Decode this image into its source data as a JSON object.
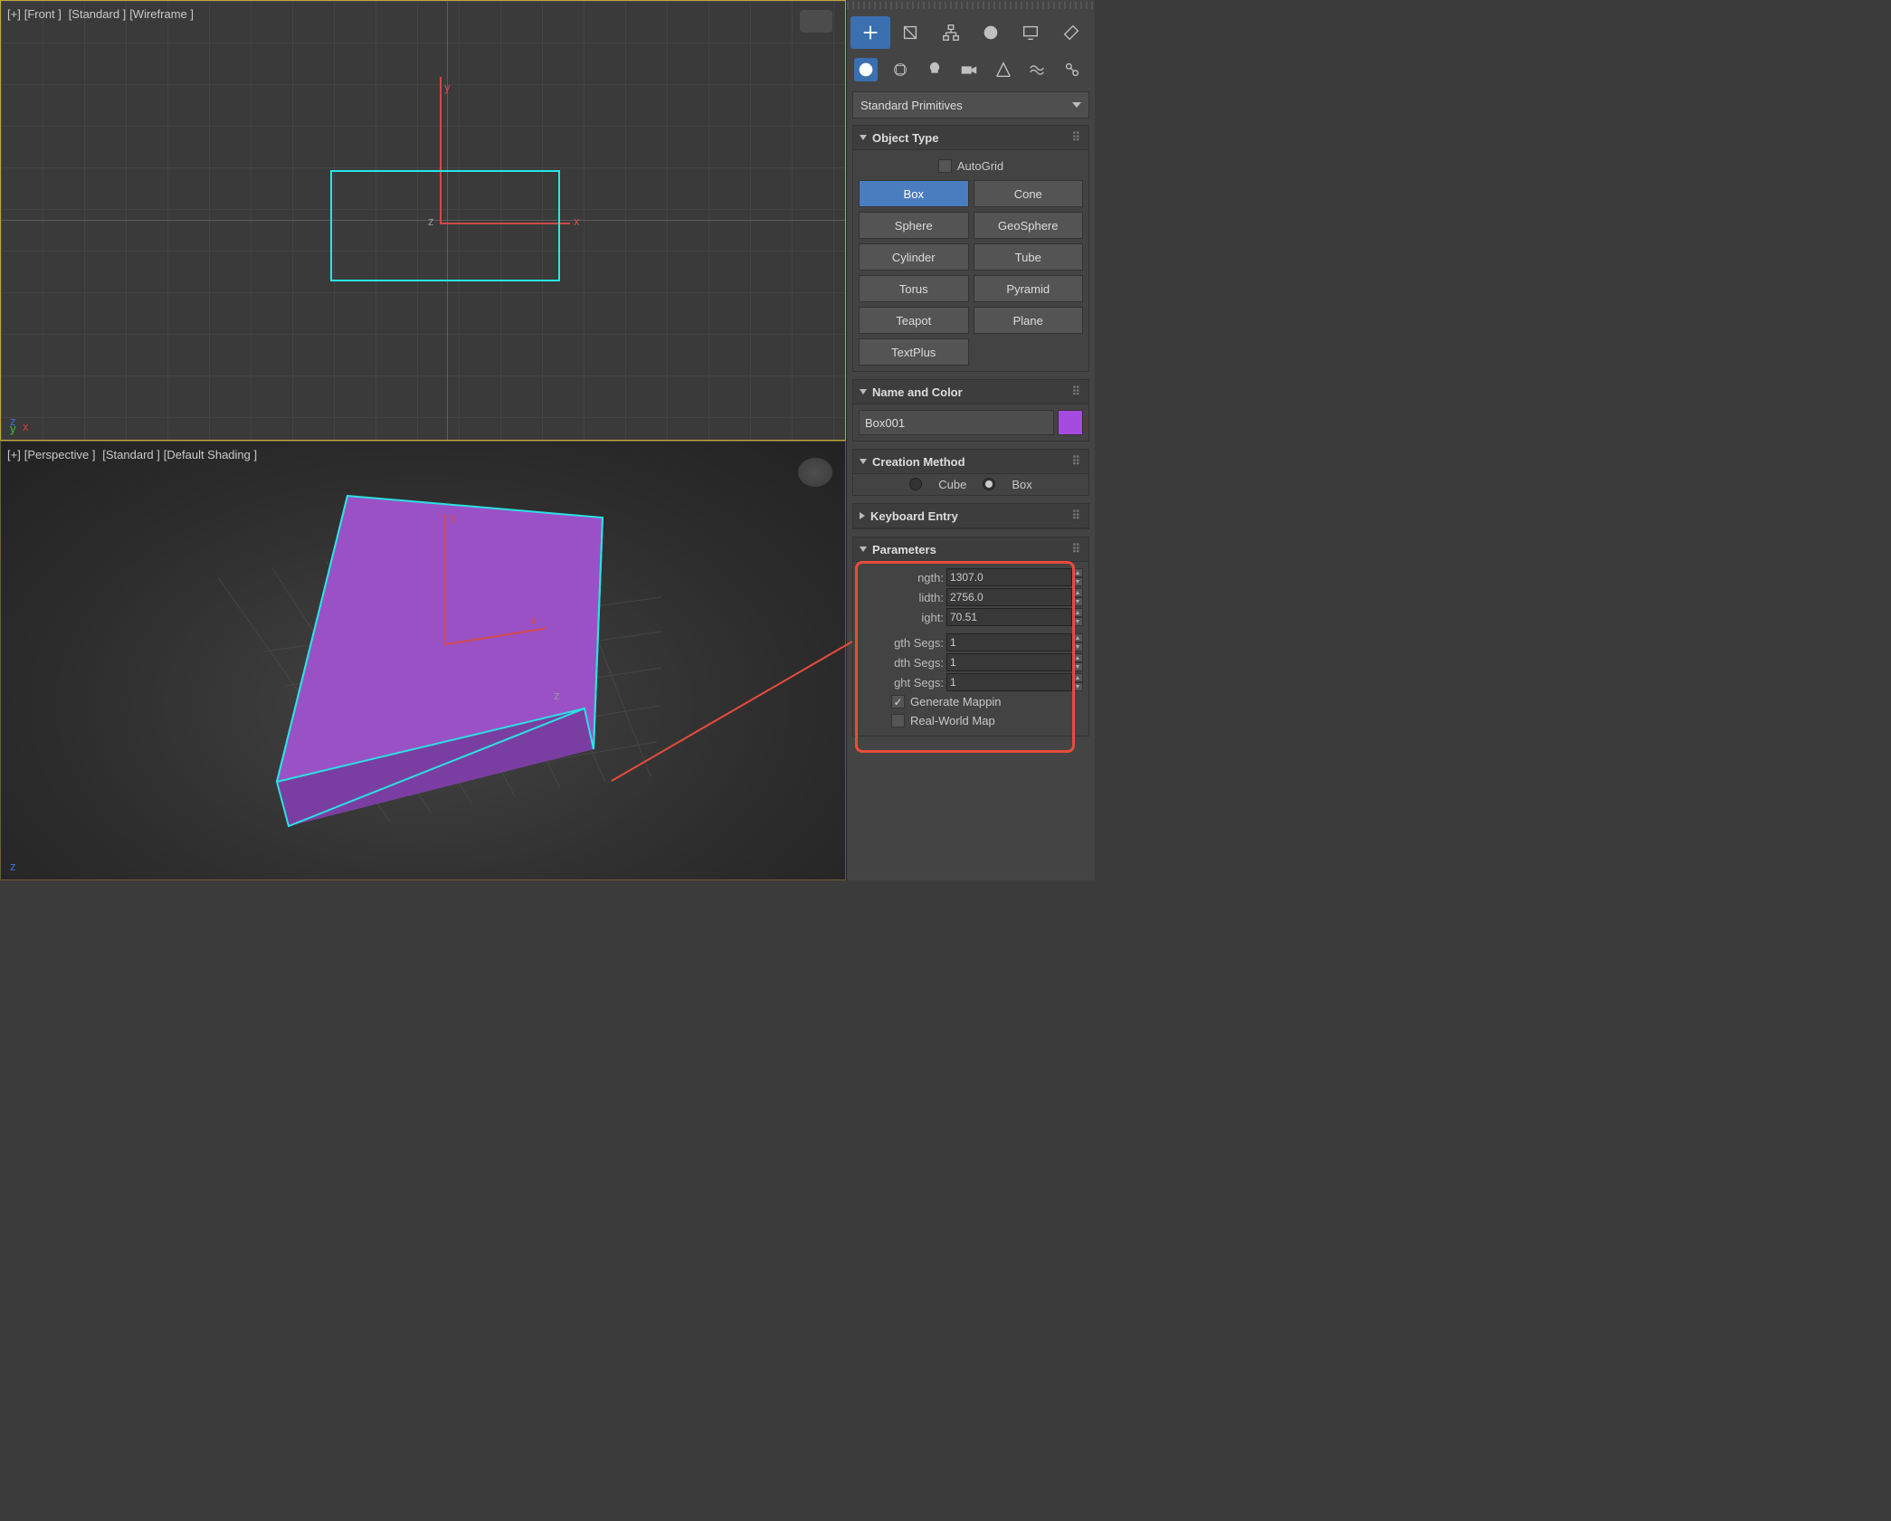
{
  "viewports": {
    "front": {
      "plus": "[+]",
      "view": "[Front ]",
      "shading": "[Standard ]",
      "mode": "[Wireframe ]"
    },
    "persp": {
      "plus": "[+]",
      "view": "[Perspective ]",
      "shading": "[Standard ]",
      "mode": "[Default Shading ]"
    }
  },
  "primitives_dropdown": "Standard Primitives",
  "rollouts": {
    "object_type": "Object Type",
    "name_color": "Name and Color",
    "creation_method": "Creation Method",
    "keyboard_entry": "Keyboard Entry",
    "parameters": "Parameters"
  },
  "autogrid_label": "AutoGrid",
  "object_buttons": [
    [
      "Box",
      "Cone"
    ],
    [
      "Sphere",
      "GeoSphere"
    ],
    [
      "Cylinder",
      "Tube"
    ],
    [
      "Torus",
      "Pyramid"
    ],
    [
      "Teapot",
      "Plane"
    ],
    [
      "TextPlus",
      ""
    ]
  ],
  "selected_object_button": "Box",
  "object_name": "Box001",
  "creation": {
    "cube": "Cube",
    "box": "Box",
    "selected": "box"
  },
  "parameters": {
    "length": {
      "label": "ngth:",
      "value": "1307.0"
    },
    "width": {
      "label": "lidth:",
      "value": "2756.0"
    },
    "height": {
      "label": "ight:",
      "value": "70.51"
    },
    "lsegs": {
      "label": "gth Segs:",
      "value": "1"
    },
    "wsegs": {
      "label": "dth Segs:",
      "value": "1"
    },
    "hsegs": {
      "label": "ght Segs:",
      "value": "1"
    },
    "gen_map": "Generate Mappin",
    "real_world": "Real-World Map"
  },
  "axis_labels": {
    "x": "x",
    "y": "y",
    "z": "z"
  },
  "corner_axes": {
    "top": {
      "z": "z",
      "y": "y",
      "x": "x"
    },
    "bot": {
      "z": "z"
    }
  }
}
